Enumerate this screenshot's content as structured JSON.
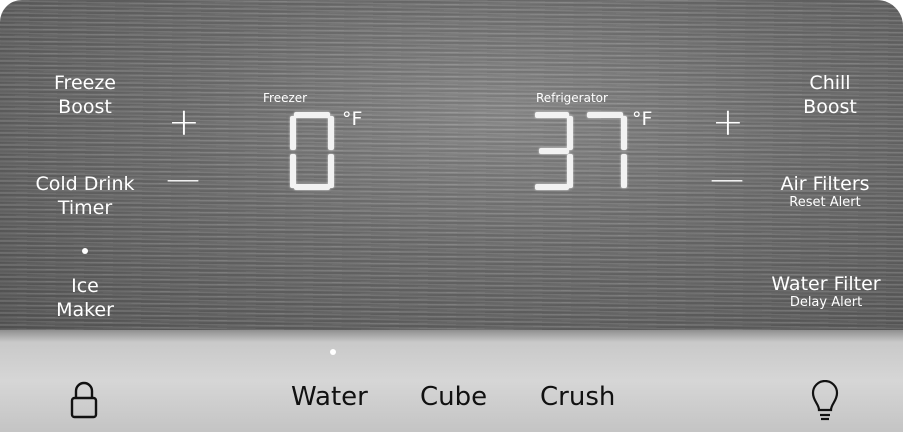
{
  "left_controls": {
    "freeze_boost": "Freeze\nBoost",
    "cold_drink_timer": "Cold Drink\nTimer",
    "ice_maker": "Ice\nMaker"
  },
  "right_controls": {
    "chill_boost": "Chill\nBoost",
    "air_filters": "Air Filters",
    "air_filters_sub": "Reset Alert",
    "water_filter": "Water Filter",
    "water_filter_sub": "Delay Alert"
  },
  "freezer": {
    "label": "Freezer",
    "value": "0",
    "unit": "°F"
  },
  "refrigerator": {
    "label": "Refrigerator",
    "value": "37",
    "unit": "°F"
  },
  "signs": {
    "plus": "+",
    "minus": "—"
  },
  "dispenser": {
    "water": "Water",
    "cube": "Cube",
    "crush": "Crush",
    "selected": "Water"
  },
  "icons": {
    "lock": "lock-icon",
    "light": "light-bulb-icon"
  }
}
